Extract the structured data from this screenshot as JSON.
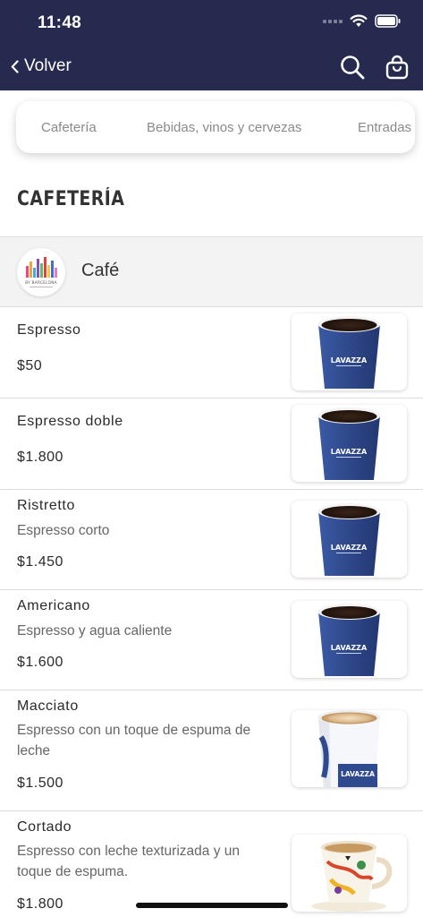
{
  "status": {
    "time": "11:48"
  },
  "nav": {
    "back_label": "Volver"
  },
  "tabs": [
    {
      "label": "Cafetería"
    },
    {
      "label": "Bebidas, vinos y cervezas"
    },
    {
      "label": "Entradas"
    }
  ],
  "section": {
    "title": "CAFETERÍA"
  },
  "category": {
    "name": "Café",
    "logo_text": "BY BARCELONA"
  },
  "items": [
    {
      "name": "Espresso",
      "description": "",
      "price": "$50",
      "image": "lavazza-cup"
    },
    {
      "name": "Espresso doble",
      "description": "",
      "price": "$1.800",
      "image": "lavazza-cup"
    },
    {
      "name": "Ristretto",
      "description": "Espresso corto",
      "price": "$1.450",
      "image": "lavazza-cup"
    },
    {
      "name": "Americano",
      "description": "Espresso y agua caliente",
      "price": "$1.600",
      "image": "lavazza-cup"
    },
    {
      "name": "Macciato",
      "description": "Espresso con un toque de espuma de leche",
      "price": "$1.500",
      "image": "lavazza-latte-cup"
    },
    {
      "name": "Cortado",
      "description": "Espresso con leche texturizada y un toque de espuma.",
      "price": "$1.800",
      "image": "decorated-cup"
    }
  ],
  "colors": {
    "header_bg": "#262a4e",
    "brand_cup": "#2f4a8e"
  }
}
